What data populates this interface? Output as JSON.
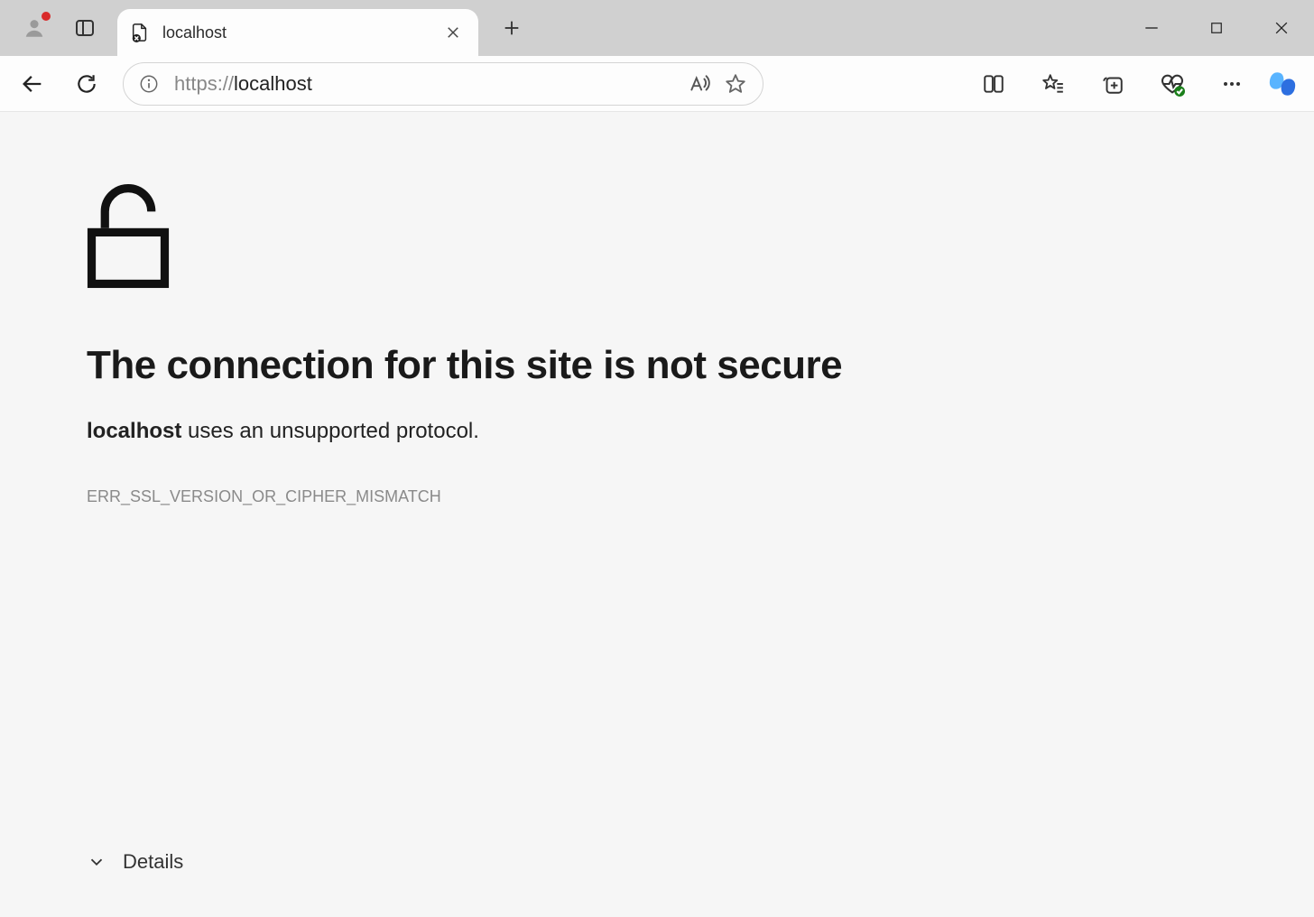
{
  "tab": {
    "title": "localhost"
  },
  "address_bar": {
    "scheme": "https://",
    "host": "localhost",
    "rest": ""
  },
  "error_page": {
    "heading": "The connection for this site is not secure",
    "host_name": "localhost",
    "message_suffix": " uses an unsupported protocol.",
    "error_code": "ERR_SSL_VERSION_OR_CIPHER_MISMATCH",
    "details_label": "Details"
  }
}
